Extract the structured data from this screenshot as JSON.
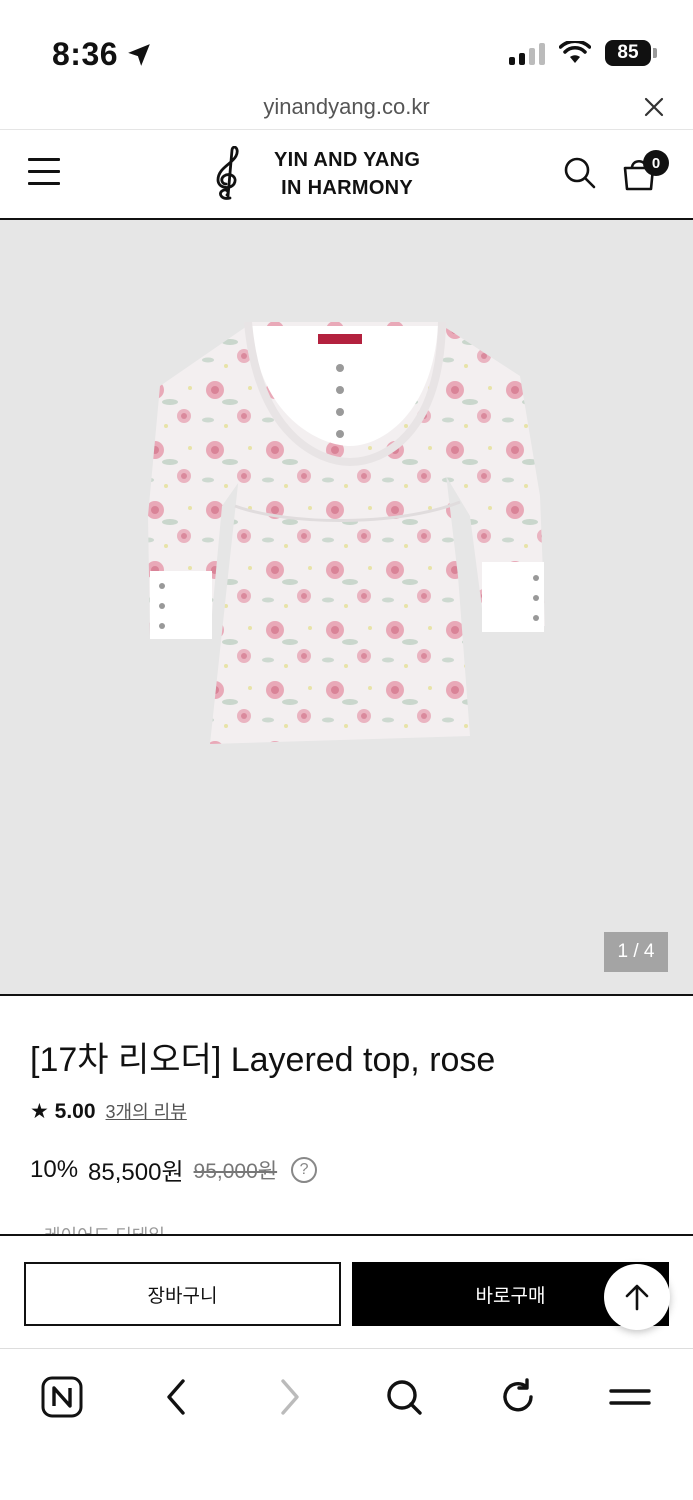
{
  "status_bar": {
    "time": "8:36",
    "battery": "85",
    "icons": [
      "location-arrow-icon",
      "signal-icon",
      "wifi-icon",
      "battery-icon"
    ]
  },
  "url_bar": {
    "url": "yinandyang.co.kr"
  },
  "header": {
    "logo_line1": "YIN AND YANG",
    "logo_line2": "IN HARMONY",
    "cart_count": "0"
  },
  "gallery": {
    "pager": "1 / 4"
  },
  "product": {
    "title": "[17차 리오더] Layered top, rose",
    "rating": "★ 5.00",
    "reviews": "3개의 리뷰",
    "discount": "10%",
    "price": "85,500원",
    "original_price": "95,000원",
    "help": "?",
    "partial_text": "레이어드 디테일"
  },
  "buy_bar": {
    "cart_label": "장바구니",
    "buy_label": "바로구매"
  },
  "colors": {
    "accent": "#000000",
    "gallery_bg": "#e6e6e6",
    "rose": "#e7a1b2"
  }
}
